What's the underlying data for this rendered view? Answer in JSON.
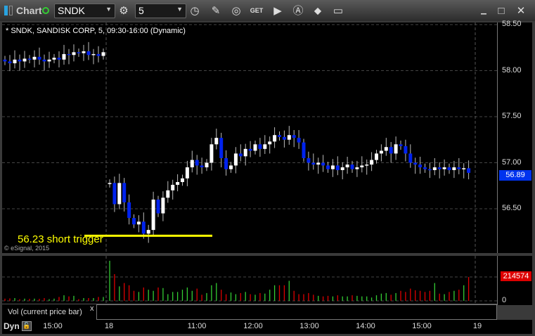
{
  "toolbar": {
    "title": "Chart",
    "symbol": "SNDK",
    "interval": "5",
    "icons": [
      "settings-icon",
      "clock-icon",
      "pencil-icon",
      "study-icon",
      "get-icon",
      "play-icon",
      "alert-icon",
      "link-icon",
      "comment-icon"
    ]
  },
  "window": {
    "min": "▁",
    "max": "□",
    "close": "✕"
  },
  "chart": {
    "header": "* SNDK, SANDISK CORP, 5, 09:30-16:00 (Dynamic)",
    "copyright": "© eSignal, 2015",
    "annotation": "56.23 short trigger",
    "annotation_price": 56.23,
    "last_price": "56.89"
  },
  "chart_data": {
    "type": "candlestick",
    "yticks": [
      "58.50",
      "58.00",
      "57.50",
      "57.00",
      "56.50"
    ],
    "yvals": [
      58.5,
      58.0,
      57.5,
      57.0,
      56.5
    ],
    "xticks": [
      "15:00",
      "18",
      "11:00",
      "12:00",
      "13:00",
      "14:00",
      "15:00",
      "19"
    ],
    "day1_closes": [
      58.1,
      58.08,
      58.12,
      58.1,
      58.13,
      58.12,
      58.15,
      58.12,
      58.1,
      58.12,
      58.14,
      58.12,
      58.18,
      58.17,
      58.2,
      58.19,
      58.21,
      58.17,
      58.18,
      58.16,
      58.2
    ],
    "day2_closes": [
      56.78,
      56.55,
      56.78,
      56.57,
      56.4,
      56.33,
      56.36,
      56.23,
      56.27,
      56.6,
      56.45,
      56.62,
      56.7,
      56.76,
      56.79,
      56.83,
      56.95,
      57.03,
      56.97,
      56.95,
      57.0,
      57.2,
      57.27,
      57.05,
      56.93,
      56.97,
      57.1,
      57.07,
      57.15,
      57.13,
      57.2,
      57.15,
      57.2,
      57.23,
      57.3,
      57.28,
      57.25,
      57.3,
      57.27,
      57.22,
      57.05,
      57.0,
      56.98,
      57.0,
      56.97,
      56.93,
      56.97,
      56.92,
      56.95,
      56.98,
      56.93,
      56.95,
      56.97,
      56.98,
      57.03,
      57.1,
      57.13,
      57.17,
      57.1,
      57.2,
      57.18,
      57.1,
      57.0,
      56.98,
      56.95,
      56.93,
      56.92,
      56.95,
      56.93,
      56.95,
      56.92,
      56.95,
      56.93,
      56.94,
      56.89
    ],
    "volume": {
      "label": "Vol (current price bar)",
      "last": "214574",
      "zero": "0",
      "day1": [
        20,
        22,
        25,
        15,
        20,
        18,
        20,
        18,
        25,
        15,
        20,
        35,
        50,
        40,
        45,
        15,
        25,
        25,
        25,
        35,
        35
      ],
      "day2": [
        360,
        240,
        130,
        160,
        140,
        90,
        80,
        120,
        100,
        90,
        120,
        115,
        60,
        80,
        80,
        100,
        120,
        90,
        110,
        55,
        70,
        140,
        160,
        100,
        60,
        75,
        60,
        70,
        80,
        60,
        55,
        70,
        65,
        100,
        140,
        140,
        140,
        180,
        90,
        60,
        60,
        70,
        55,
        45,
        40,
        45,
        40,
        50,
        40,
        40,
        50,
        45,
        40,
        40,
        30,
        50,
        65,
        70,
        55,
        70,
        90,
        80,
        110,
        95,
        90,
        80,
        90,
        160,
        65,
        60,
        80,
        90,
        100,
        140,
        214
      ]
    }
  }
}
